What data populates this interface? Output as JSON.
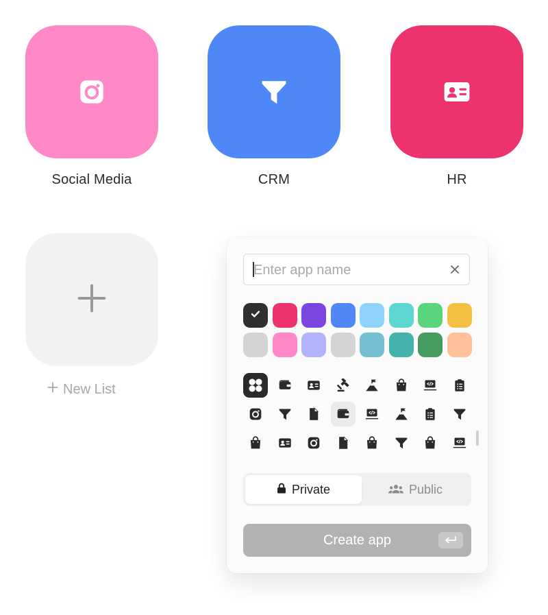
{
  "apps": [
    {
      "label": "Social Media",
      "color": "#ff88c6",
      "icon": "instagram-icon"
    },
    {
      "label": "CRM",
      "color": "#4f87f6",
      "icon": "funnel-icon"
    },
    {
      "label": "HR",
      "color": "#ec336d",
      "icon": "id-card-icon"
    }
  ],
  "new_list": {
    "label": "New List",
    "icon": "plus-icon"
  },
  "create_panel": {
    "name_placeholder": "Enter app name",
    "name_value": "",
    "colors": [
      "#2f2f2f",
      "#ec336d",
      "#7b45e0",
      "#4f87f6",
      "#8fd3fb",
      "#5dd8d1",
      "#5ad57e",
      "#f3c043",
      "#d4d4d4",
      "#ff88c6",
      "#b3b2fd",
      "#d4d4d4",
      "#74c0d2",
      "#46b2ac",
      "#469c5f",
      "#ffc09a"
    ],
    "selected_color_index": 0,
    "icons": [
      "grid-icon",
      "wallet-icon",
      "id-card-icon",
      "gavel-icon",
      "mountain-flag-icon",
      "shopping-bag-icon",
      "code-laptop-icon",
      "clipboard-list-icon",
      "instagram-icon",
      "funnel-icon",
      "file-icon",
      "wallet-icon",
      "code-laptop-icon",
      "mountain-flag-icon",
      "clipboard-list-icon",
      "funnel-icon",
      "shopping-bag-icon",
      "id-card-icon",
      "instagram-icon",
      "file-icon",
      "shopping-bag-icon",
      "funnel-icon",
      "shopping-bag-icon",
      "code-laptop-icon"
    ],
    "selected_icon_index": 0,
    "hovered_icon_index": 11,
    "visibility": {
      "private_label": "Private",
      "public_label": "Public",
      "selected": "private"
    },
    "create_label": "Create app"
  }
}
